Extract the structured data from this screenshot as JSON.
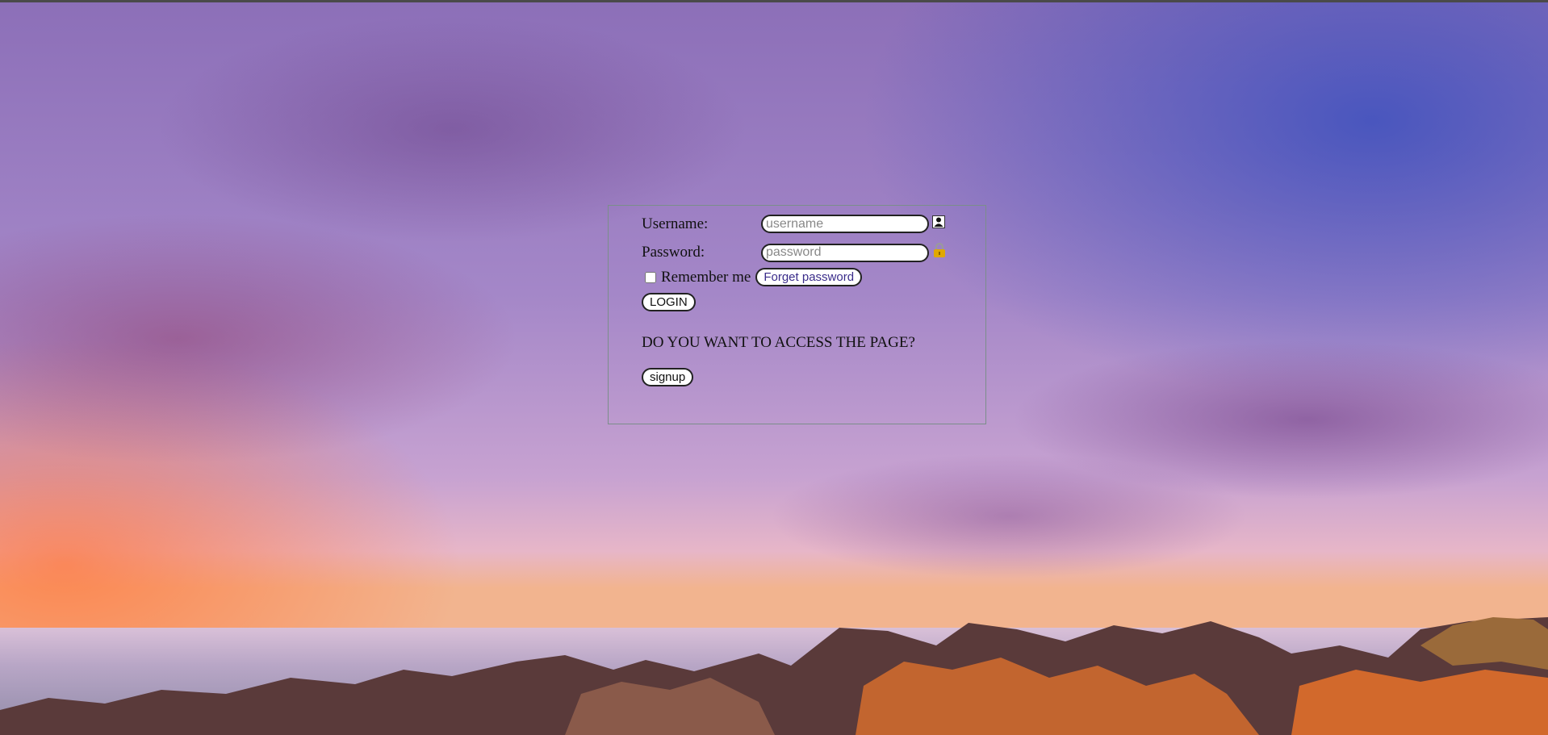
{
  "login_form": {
    "username_label": "Username:",
    "username_placeholder": "username",
    "username_icon": "user-icon",
    "password_label": "Password:",
    "password_placeholder": "password",
    "password_icon": "lock-icon",
    "remember_label": "Remember me",
    "forget_label": "Forget password",
    "login_label": "LOGIN"
  },
  "access": {
    "question": "DO YOU WANT TO ACCESS THE PAGE?",
    "signup_label": "signup"
  },
  "colors": {
    "panel_border": "#7b8e8a",
    "lock_icon": "#e0a800"
  }
}
